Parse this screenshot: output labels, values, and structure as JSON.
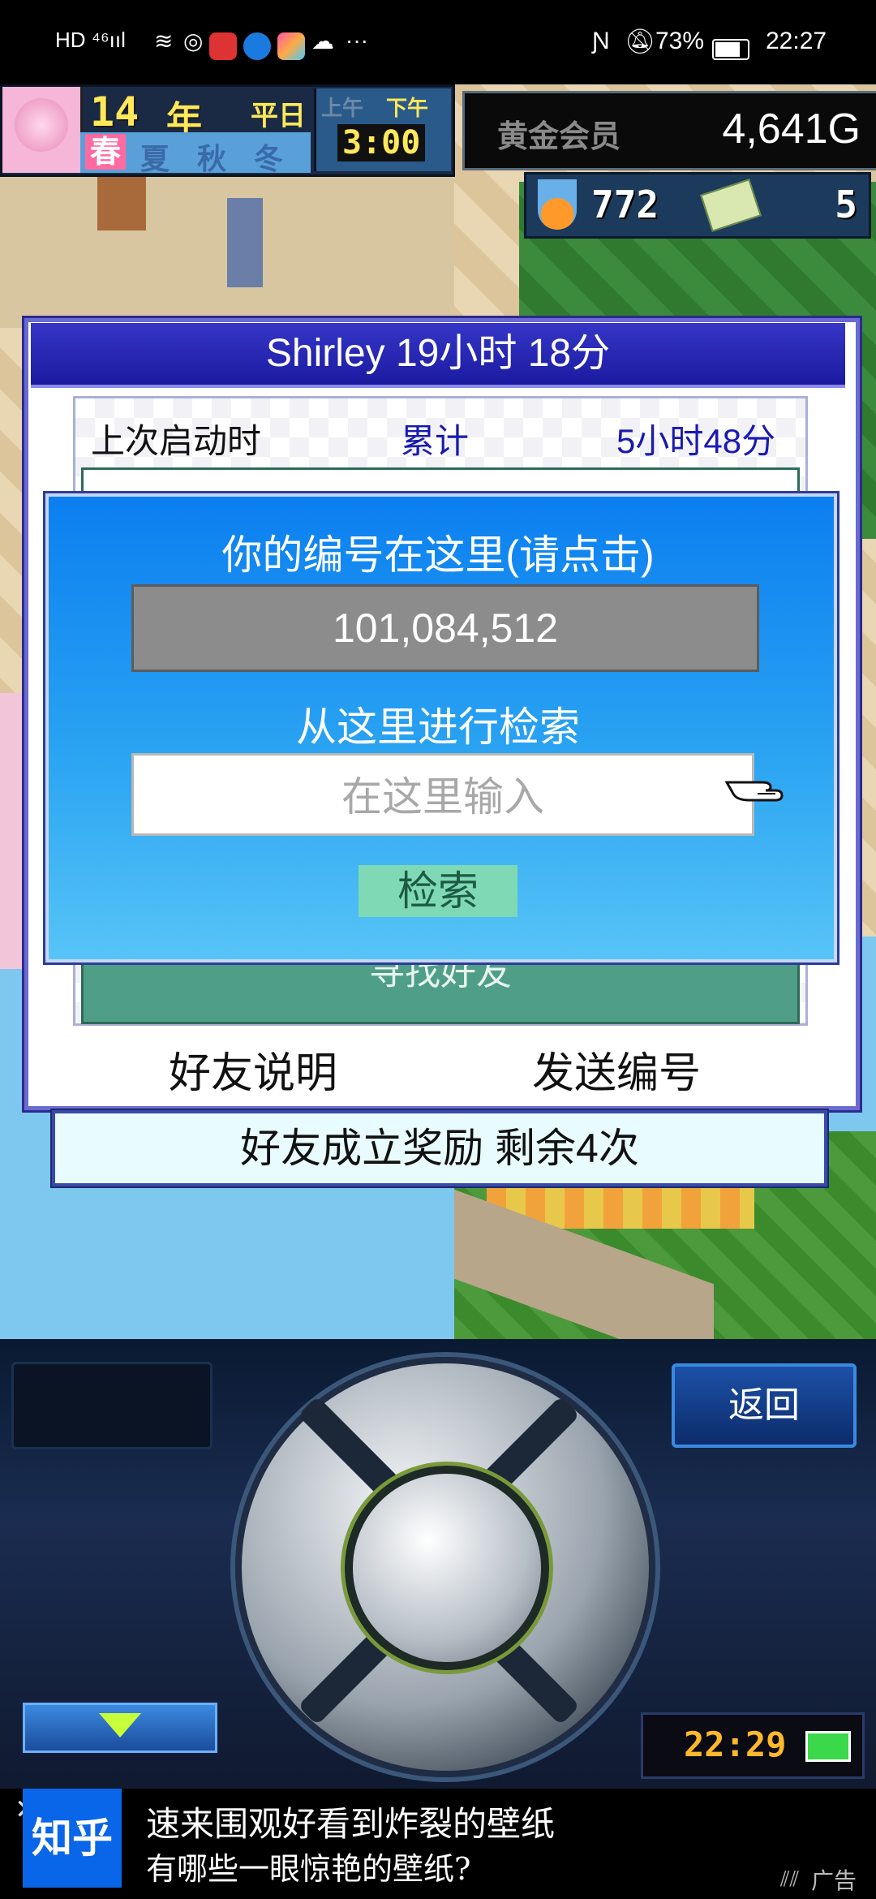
{
  "status_bar": {
    "left_text": "HD ⁴⁶ııl",
    "battery": "73%",
    "time": "22:27"
  },
  "hud": {
    "year": "14",
    "year_unit": "年",
    "weekday": "平日",
    "seasons": [
      "春",
      "夏",
      "秋",
      "冬"
    ],
    "am_pm": [
      "上午",
      "下午"
    ],
    "game_time": "3:00",
    "membership": "黄金会员",
    "money": "4,641G",
    "research_points": "772",
    "tickets": "5"
  },
  "panel": {
    "title": "Shirley  19小时 18分",
    "last_launch_label": "上次启动时",
    "total_label": "累计",
    "total_value": "5小时48分",
    "find_friend_label": "寻找好友",
    "friend_explain": "好友说明",
    "send_id": "发送编号",
    "reward": "好友成立奖励  剩余4次"
  },
  "dialog": {
    "heading": "你的编号在这里(请点击)",
    "my_id": "101,084,512",
    "search_heading": "从这里进行检索",
    "search_placeholder": "在这里输入",
    "search_button": "检索"
  },
  "device": {
    "back_button": "返回",
    "clock": "22:29"
  },
  "ad": {
    "brand": "知乎",
    "line1": "速来围观好看到炸裂的壁纸",
    "line2": "有哪些一眼惊艳的壁纸?",
    "tag": "广告"
  },
  "colors": {
    "panel_border": "#6a6ad0",
    "dialog_blue": "#0b7ff0",
    "search_button": "#7fd9b4",
    "find_friend": "#4f9e88"
  }
}
